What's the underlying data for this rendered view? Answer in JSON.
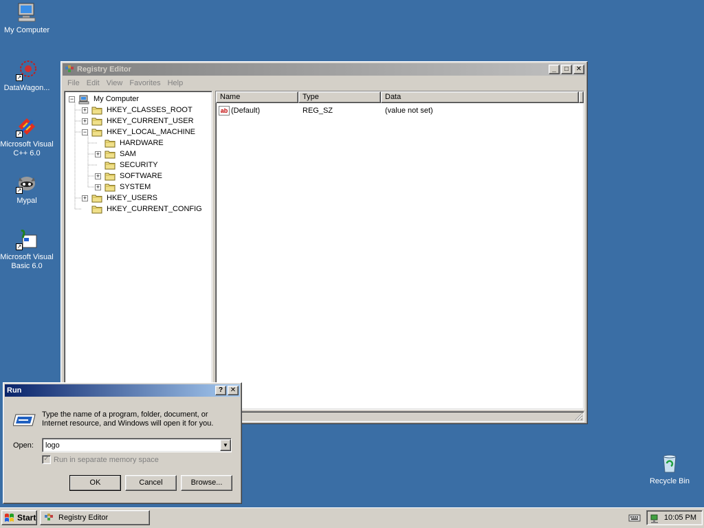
{
  "desktop": {
    "icons": [
      {
        "label": "My Computer",
        "icon": "my-computer-icon"
      },
      {
        "label": "DataWagon...",
        "icon": "datawagon-icon"
      },
      {
        "label": "Microsoft Visual C++ 6.0",
        "icon": "visual-cpp-icon"
      },
      {
        "label": "Mypal",
        "icon": "mypal-icon"
      },
      {
        "label": "Microsoft Visual Basic 6.0",
        "icon": "visual-basic-icon"
      },
      {
        "label": "Recycle Bin",
        "icon": "recycle-bin-icon"
      }
    ]
  },
  "registry": {
    "title": "Registry Editor",
    "menu": [
      "File",
      "Edit",
      "View",
      "Favorites",
      "Help"
    ],
    "tree": [
      {
        "label": "My Computer",
        "expander": "−",
        "depth": 0
      },
      {
        "label": "HKEY_CLASSES_ROOT",
        "expander": "+",
        "depth": 1
      },
      {
        "label": "HKEY_CURRENT_USER",
        "expander": "+",
        "depth": 1
      },
      {
        "label": "HKEY_LOCAL_MACHINE",
        "expander": "−",
        "depth": 1
      },
      {
        "label": "HARDWARE",
        "expander": "",
        "depth": 2
      },
      {
        "label": "SAM",
        "expander": "+",
        "depth": 2
      },
      {
        "label": "SECURITY",
        "expander": "",
        "depth": 2
      },
      {
        "label": "SOFTWARE",
        "expander": "+",
        "depth": 2
      },
      {
        "label": "SYSTEM",
        "expander": "+",
        "depth": 2
      },
      {
        "label": "HKEY_USERS",
        "expander": "+",
        "depth": 1
      },
      {
        "label": "HKEY_CURRENT_CONFIG",
        "expander": "",
        "depth": 1
      }
    ],
    "columns": [
      "Name",
      "Type",
      "Data"
    ],
    "rows": [
      {
        "name": "(Default)",
        "type": "REG_SZ",
        "data": "(value not set)"
      }
    ],
    "window_buttons": {
      "minimize": "_",
      "maximize": "□",
      "close": "✕"
    }
  },
  "run": {
    "title": "Run",
    "help_button": "?",
    "close_button": "✕",
    "description": "Type the name of a program, folder, document, or Internet resource, and Windows will open it for you.",
    "open_label": "Open:",
    "open_value": "logo",
    "checkbox_label": "Run in separate memory space",
    "checkbox_checked": true,
    "ok": "OK",
    "cancel": "Cancel",
    "browse": "Browse..."
  },
  "taskbar": {
    "start": "Start",
    "task": "Registry Editor",
    "clock": "10:05 PM"
  },
  "colors": {
    "desktop": "#3a6ea5",
    "active_title": "#0a246a",
    "inactive_title": "#808080",
    "face": "#d4d0c8"
  }
}
